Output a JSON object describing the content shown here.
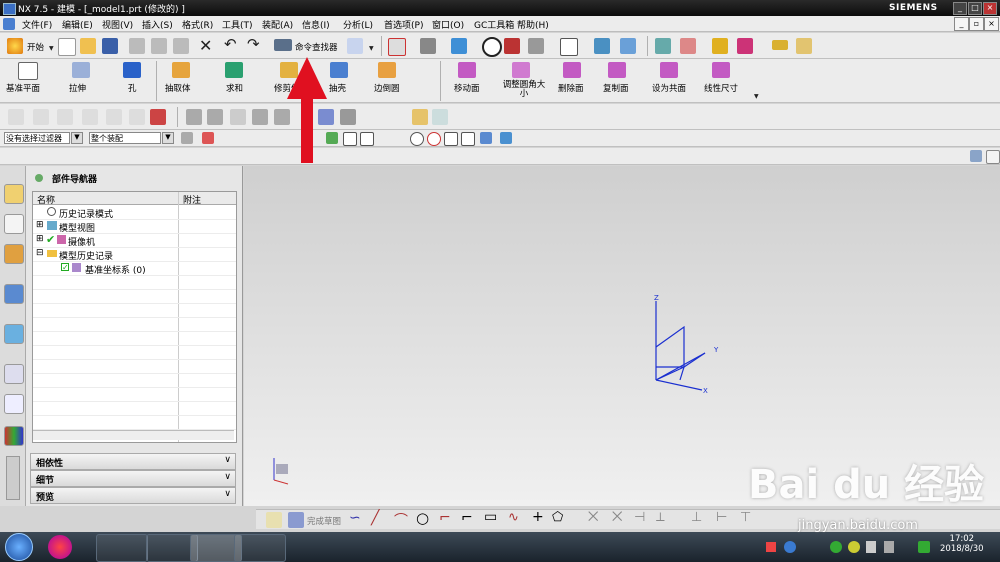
{
  "window": {
    "title": "NX 7.5 - 建模 - [_model1.prt  (修改的) ]",
    "brand": "SIEMENS",
    "minimize": "_",
    "maximize": "□",
    "close": "×"
  },
  "menu": [
    "文件(F)",
    "编辑(E)",
    "视图(V)",
    "插入(S)",
    "格式(R)",
    "工具(T)",
    "装配(A)",
    "信息(I)",
    "分析(L)",
    "首选项(P)",
    "窗口(O)",
    "GC工具箱",
    "帮助(H)"
  ],
  "toolbar1": {
    "start_label": "开始",
    "command_finder_label": "命令查找器"
  },
  "toolbar2": {
    "items": [
      "基准平面",
      "拉伸",
      "孔",
      "抽取体",
      "求和",
      "修剪体",
      "抽壳",
      "边倒圆",
      "移动面",
      "调整圆角大小",
      "删除面",
      "复制面",
      "设为共面",
      "线性尺寸"
    ]
  },
  "filterbar": {
    "selection_filter": "没有选择过滤器",
    "scope": "整个装配"
  },
  "navigator": {
    "title": "部件导航器",
    "col_name": "名称",
    "col_note": "附注",
    "nodes": [
      "历史记录模式",
      "模型视图",
      "摄像机",
      "模型历史记录",
      "基准坐标系 (0)"
    ],
    "panels": [
      "相依性",
      "细节",
      "预览"
    ]
  },
  "canvas": {
    "axis_x": "X",
    "axis_y": "Y",
    "axis_z": "Z"
  },
  "sketchbar": {
    "finish_sketch": "完成草图"
  },
  "taskbar": {
    "time": "17:02",
    "date": "2018/8/30"
  },
  "watermark": {
    "text": "Bai du 经验",
    "url": "jingyan.baidu.com"
  },
  "colors": {
    "accent_arrow": "#e01020",
    "axis_blue": "#1a2fd0",
    "title_bg": "#111111"
  }
}
